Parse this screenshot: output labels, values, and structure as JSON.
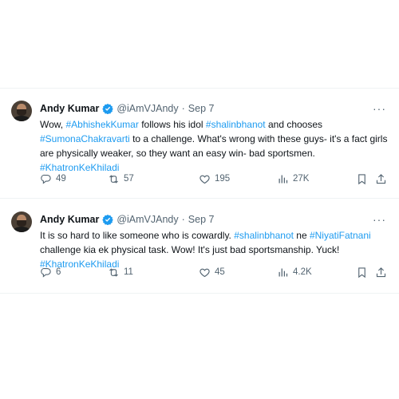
{
  "tweets": [
    {
      "author_name": "Andy Kumar",
      "handle": "@iAmVJAndy",
      "separator": "·",
      "date": "Sep 7",
      "text_parts": [
        {
          "t": "Wow, ",
          "tag": false
        },
        {
          "t": "#AbhishekKumar",
          "tag": true
        },
        {
          "t": " follows his idol ",
          "tag": false
        },
        {
          "t": "#shalinbhanot",
          "tag": true
        },
        {
          "t": " and chooses ",
          "tag": false
        },
        {
          "t": "#SumonaChakravarti",
          "tag": true
        },
        {
          "t": " to a challenge. What's wrong with these guys- it's a fact girls are physically weaker, so they want an easy win- bad sportsmen. ",
          "tag": false
        },
        {
          "t": "#KhatronKeKhiladi",
          "tag": true
        }
      ],
      "replies": "49",
      "retweets": "57",
      "likes": "195",
      "views": "27K"
    },
    {
      "author_name": "Andy Kumar",
      "handle": "@iAmVJAndy",
      "separator": "·",
      "date": "Sep 7",
      "text_parts": [
        {
          "t": "It is so hard to like someone who is cowardly. ",
          "tag": false
        },
        {
          "t": "#shalinbhanot",
          "tag": true
        },
        {
          "t": " ne ",
          "tag": false
        },
        {
          "t": "#NiyatiFatnani",
          "tag": true
        },
        {
          "t": " challenge kia ek physical task. Wow! It's just bad sportsmanship. Yuck! ",
          "tag": false
        },
        {
          "t": "#KhatronKeKhiladi",
          "tag": true
        }
      ],
      "replies": "6",
      "retweets": "11",
      "likes": "45",
      "views": "4.2K"
    }
  ],
  "icons": {
    "more": "more-icon",
    "reply": "reply-icon",
    "retweet": "retweet-icon",
    "like": "like-icon",
    "views": "views-icon",
    "bookmark": "bookmark-icon",
    "share": "share-icon",
    "verified": "verified-badge-icon"
  },
  "colors": {
    "accent": "#1d9bf0",
    "muted": "#536471",
    "text": "#0f1419"
  },
  "more_glyph": "···"
}
